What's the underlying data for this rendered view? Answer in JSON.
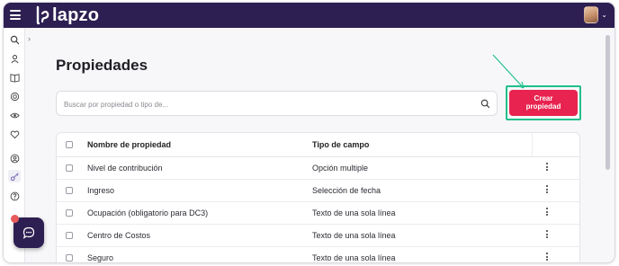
{
  "app": {
    "logo_text": "lapzo"
  },
  "page": {
    "title": "Propiedades"
  },
  "search": {
    "placeholder": "Buscar por propiedad o tipo de..."
  },
  "actions": {
    "create_label_line1": "Crear",
    "create_label_line2": "propiedad"
  },
  "table": {
    "headers": {
      "name": "Nombre de propiedad",
      "type": "Tipo de campo"
    },
    "rows": [
      {
        "name": "Nivel de contribución",
        "type": "Opción multiple"
      },
      {
        "name": "Ingreso",
        "type": "Selección de fecha"
      },
      {
        "name": "Ocupación (obligatorio para DC3)",
        "type": "Texto de una sola línea"
      },
      {
        "name": "Centro de Costos",
        "type": "Texto de una sola línea"
      },
      {
        "name": "Seguro",
        "type": "Texto de una sola línea"
      }
    ]
  },
  "colors": {
    "topbar": "#2d1f52",
    "primary_button": "#e8234f",
    "highlight": "#22c08a"
  },
  "rail_icons": [
    "search-icon",
    "user-icon",
    "book-icon",
    "target-icon",
    "eye-icon",
    "heart-icon",
    "person-badge-icon",
    "key-icon",
    "help-icon"
  ]
}
